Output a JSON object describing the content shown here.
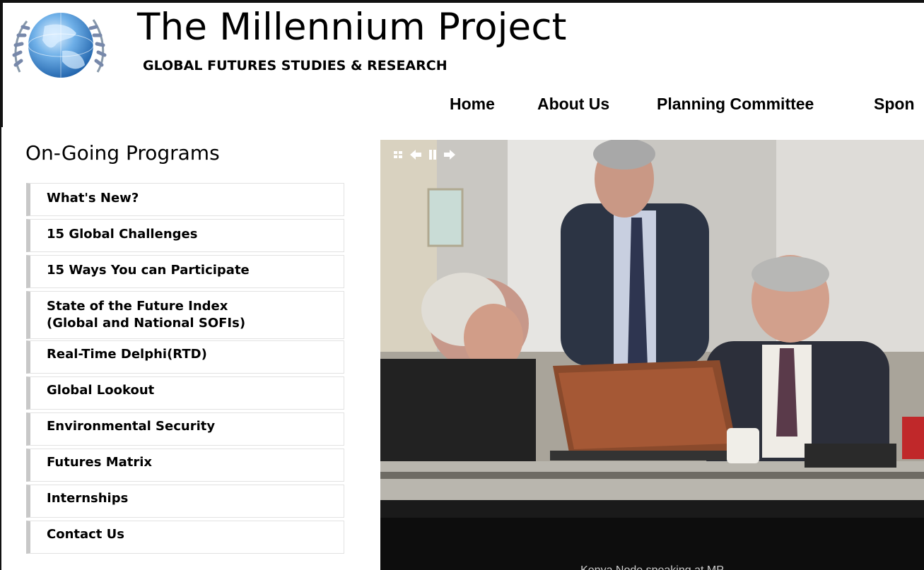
{
  "header": {
    "title": "The Millennium Project",
    "subtitle": "GLOBAL FUTURES STUDIES & RESEARCH",
    "logo_icon": "globe-laurel-icon"
  },
  "nav": {
    "items": [
      {
        "label": "Home"
      },
      {
        "label": "About Us"
      },
      {
        "label": "Planning Committee"
      },
      {
        "label": "Spon"
      }
    ]
  },
  "sidebar": {
    "title": "On-Going Programs",
    "items": [
      {
        "label": "What's New?"
      },
      {
        "label": "15 Global Challenges"
      },
      {
        "label": "15 Ways You can Participate"
      },
      {
        "label": "State of the Future Index\n(Global and National SOFIs)"
      },
      {
        "label": "Real-Time Delphi(RTD)"
      },
      {
        "label": "Global Lookout"
      },
      {
        "label": "Environmental Security"
      },
      {
        "label": "Futures Matrix"
      },
      {
        "label": "Internships"
      },
      {
        "label": "Contact Us"
      }
    ]
  },
  "slideshow": {
    "controls": [
      "grid-icon",
      "prev-arrow-icon",
      "pause-icon",
      "next-arrow-icon"
    ],
    "caption": "Kenya Node speaking at MP"
  },
  "colors": {
    "menu_border_left": "#c8c8c8",
    "menu_border": "#e2e2e2"
  }
}
